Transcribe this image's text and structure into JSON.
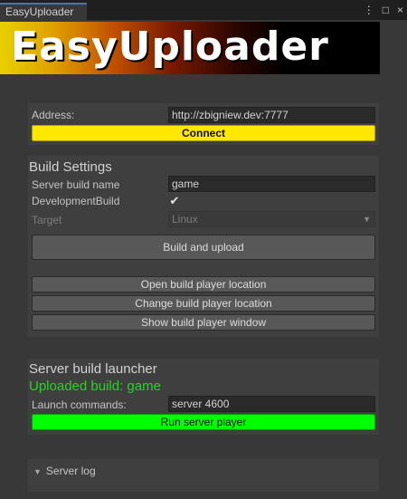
{
  "tab": {
    "title": "EasyUploader"
  },
  "window_icons": {
    "menu": "⋮",
    "maximize": "□",
    "close": "×"
  },
  "banner": {
    "text": "EasyUploader"
  },
  "connection": {
    "address_label": "Address:",
    "address_value": "http://zbigniew.dev:7777",
    "connect_label": "Connect"
  },
  "build_settings": {
    "title": "Build Settings",
    "server_build_name_label": "Server build name",
    "server_build_name_value": "game",
    "development_build_label": "DevelopmentBuild",
    "development_build_checked": true,
    "target_label": "Target",
    "target_value": "Linux",
    "build_upload_label": "Build and upload",
    "open_location_label": "Open build player location",
    "change_location_label": "Change build player location",
    "show_window_label": "Show build player window"
  },
  "launcher": {
    "title": "Server build launcher",
    "status": "Uploaded build: game",
    "launch_commands_label": "Launch commands:",
    "launch_commands_value": "server 4600",
    "run_label": "Run server player"
  },
  "log": {
    "label": "Server log"
  },
  "colors": {
    "connect": "#ffe800",
    "run": "#00ff00",
    "status_ok": "#29d12a",
    "tab_accent": "#3a79bb"
  }
}
